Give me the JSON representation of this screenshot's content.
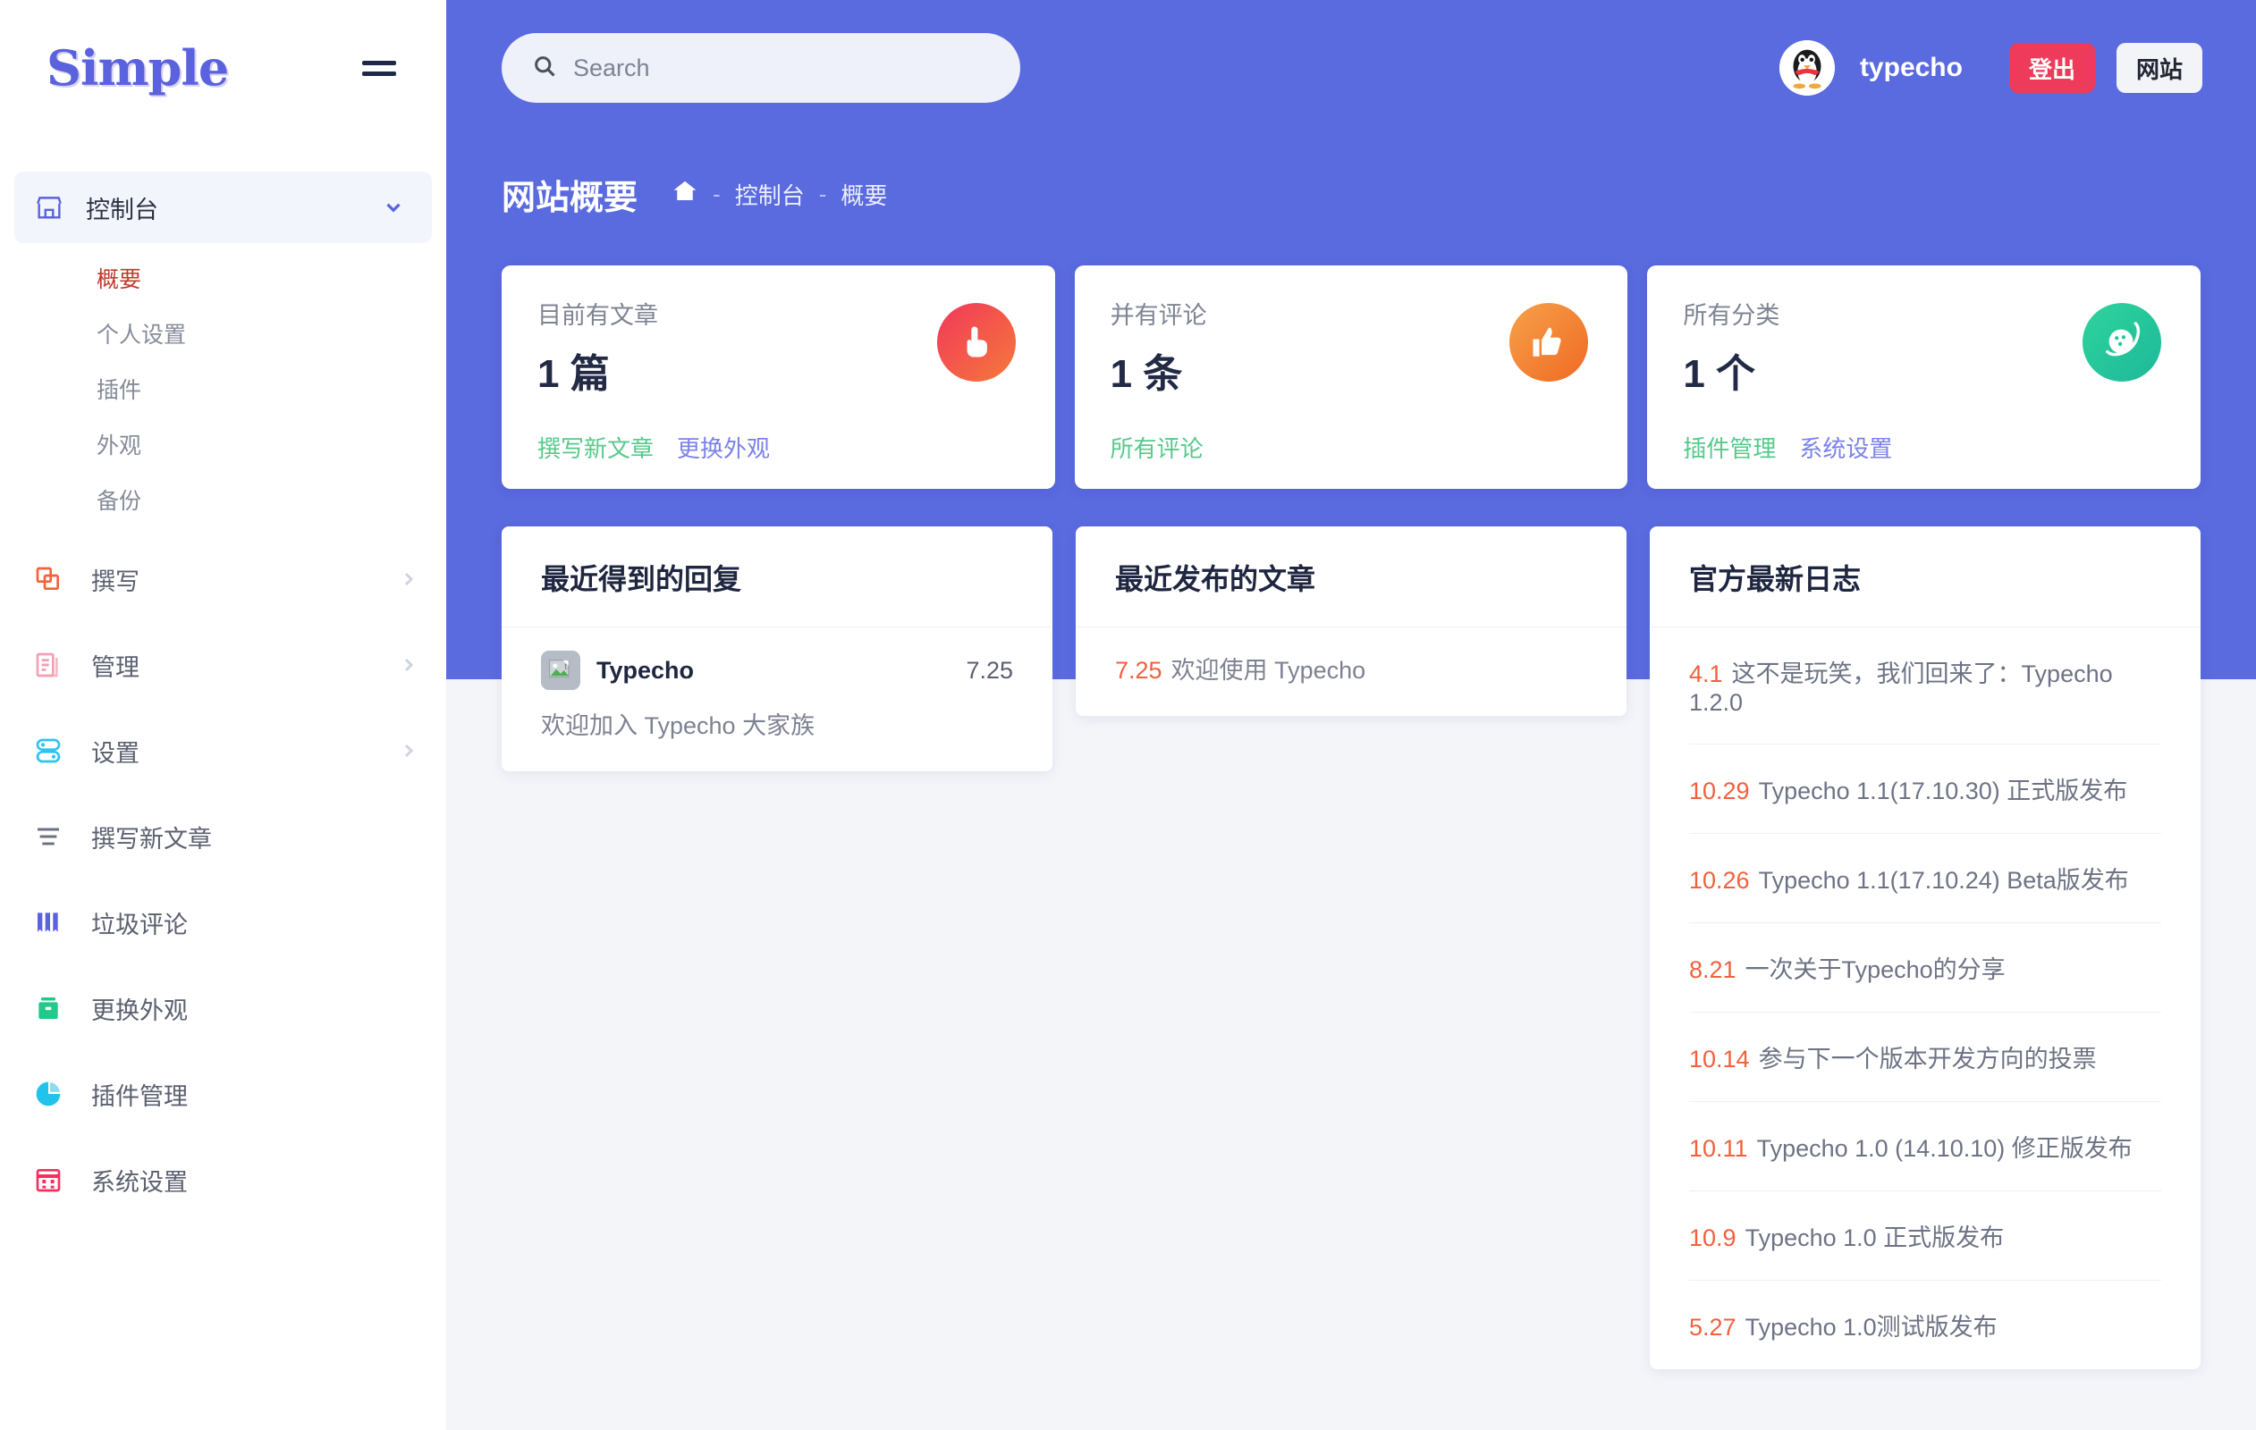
{
  "brand": {
    "name": "Simple"
  },
  "sidebar": {
    "console": {
      "label": "控制台",
      "icon": "store-icon",
      "sub": [
        {
          "label": "概要",
          "current": true
        },
        {
          "label": "个人设置",
          "current": false
        },
        {
          "label": "插件",
          "current": false
        },
        {
          "label": "外观",
          "current": false
        },
        {
          "label": "备份",
          "current": false
        }
      ]
    },
    "groups": [
      {
        "label": "撰写",
        "icon": "copy-icon",
        "color": "#f4613a"
      },
      {
        "label": "管理",
        "icon": "document-icon",
        "color": "#f2a0b4"
      },
      {
        "label": "设置",
        "icon": "toggles-icon",
        "color": "#2ec3f2"
      }
    ],
    "items": [
      {
        "label": "撰写新文章",
        "icon": "lines-icon",
        "color": "#6b7280"
      },
      {
        "label": "垃圾评论",
        "icon": "books-icon",
        "color": "#5a62de"
      },
      {
        "label": "更换外观",
        "icon": "box-icon",
        "color": "#21c98a"
      },
      {
        "label": "插件管理",
        "icon": "pie-chart-icon",
        "color": "#22c3eb"
      },
      {
        "label": "系统设置",
        "icon": "calendar-icon",
        "color": "#f4315e"
      }
    ]
  },
  "search": {
    "placeholder": "Search",
    "value": ""
  },
  "user": {
    "name": "typecho",
    "avatar": "penguin-avatar"
  },
  "buttons": {
    "logout": "登出",
    "site": "网站"
  },
  "header": {
    "title": "网站概要",
    "breadcrumb": [
      "控制台",
      "概要"
    ],
    "home_icon": "home-icon"
  },
  "stats": [
    {
      "label": "目前有文章",
      "value": "1 篇",
      "icon": "hand-point-up-icon",
      "icon_style": "ico-red",
      "links": [
        {
          "text": "撰写新文章",
          "style": "lnk-green"
        },
        {
          "text": "更换外观",
          "style": "lnk-purple"
        }
      ]
    },
    {
      "label": "并有评论",
      "value": "1 条",
      "icon": "thumbs-up-icon",
      "icon_style": "ico-orange",
      "links": [
        {
          "text": "所有评论",
          "style": "lnk-green"
        }
      ]
    },
    {
      "label": "所有分类",
      "value": "1 个",
      "icon": "planet-icon",
      "icon_style": "ico-green",
      "links": [
        {
          "text": "插件管理",
          "style": "lnk-green"
        },
        {
          "text": "系统设置",
          "style": "lnk-purple"
        }
      ]
    }
  ],
  "replies_panel": {
    "title": "最近得到的回复",
    "items": [
      {
        "author": "Typecho",
        "date": "7.25",
        "text": "欢迎加入 Typecho 大家族",
        "avatar": "broken-image-icon"
      }
    ]
  },
  "posts_panel": {
    "title": "最近发布的文章",
    "items": [
      {
        "date": "7.25",
        "title": "欢迎使用 Typecho"
      }
    ]
  },
  "log_panel": {
    "title": "官方最新日志",
    "items": [
      {
        "date": "4.1",
        "text": "这不是玩笑，我们回来了：Typecho 1.2.0"
      },
      {
        "date": "10.29",
        "text": "Typecho 1.1(17.10.30) 正式版发布"
      },
      {
        "date": "10.26",
        "text": "Typecho 1.1(17.10.24) Beta版发布"
      },
      {
        "date": "8.21",
        "text": "一次关于Typecho的分享"
      },
      {
        "date": "10.14",
        "text": "参与下一个版本开发方向的投票"
      },
      {
        "date": "10.11",
        "text": "Typecho 1.0 (14.10.10) 修正版发布"
      },
      {
        "date": "10.9",
        "text": "Typecho 1.0 正式版发布"
      },
      {
        "date": "5.27",
        "text": "Typecho 1.0测试版发布"
      }
    ]
  },
  "colors": {
    "brand_purple": "#5a6adf",
    "accent_red": "#ef3b5b",
    "accent_orange": "#f2603c",
    "accent_green": "#57c98b"
  }
}
